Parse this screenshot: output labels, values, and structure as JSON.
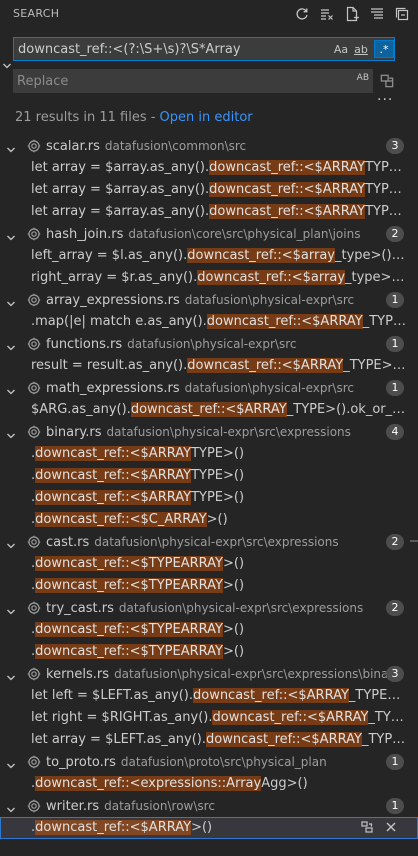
{
  "header": {
    "title": "SEARCH",
    "actions": [
      {
        "name": "refresh-icon",
        "label": "Refresh"
      },
      {
        "name": "clear-results-icon",
        "label": "Clear Search Results"
      },
      {
        "name": "new-search-editor-icon",
        "label": "Open New Search Editor"
      },
      {
        "name": "view-as-tree-icon",
        "label": "View as Tree"
      },
      {
        "name": "collapse-all-icon",
        "label": "Collapse All"
      }
    ]
  },
  "search": {
    "value": "downcast_ref::<(?:\\S+\\s)?\\S*Array",
    "match_case_label": "Aa",
    "whole_word_label": "ab",
    "regex_label": ".*"
  },
  "replace": {
    "placeholder": "Replace",
    "preserve_case_label": "AB"
  },
  "summary": {
    "text": "21 results in 11 files - ",
    "link": "Open in editor"
  },
  "files": [
    {
      "name": "scalar.rs",
      "path": "datafusion\\common\\src",
      "count": "3",
      "matches": [
        [
          {
            "t": "let array = $array.as_any()."
          },
          {
            "t": "downcast_ref::<$ARRAY",
            "h": true
          },
          {
            "t": "TYPE>().unwrap();"
          }
        ],
        [
          {
            "t": "let array = $array.as_any()."
          },
          {
            "t": "downcast_ref::<$ARRAY",
            "h": true
          },
          {
            "t": "TYPE>().unwrap();"
          }
        ],
        [
          {
            "t": "let array = $array.as_any()."
          },
          {
            "t": "downcast_ref::<$ARRAY",
            "h": true
          },
          {
            "t": "TYPE>().unwrap();"
          }
        ]
      ]
    },
    {
      "name": "hash_join.rs",
      "path": "datafusion\\core\\src\\physical_plan\\joins",
      "count": "2",
      "matches": [
        [
          {
            "t": "left_array = $l.as_any()."
          },
          {
            "t": "downcast_ref::<$array",
            "h": true
          },
          {
            "t": "_type>().unwrap();"
          }
        ],
        [
          {
            "t": "right_array = $r.as_any()."
          },
          {
            "t": "downcast_ref::<$array",
            "h": true
          },
          {
            "t": "_type>().unwrap();"
          }
        ]
      ]
    },
    {
      "name": "array_expressions.rs",
      "path": "datafusion\\physical-expr\\src",
      "count": "1",
      "matches": [
        [
          {
            "t": ".map(|e| match e.as_any()."
          },
          {
            "t": "downcast_ref::<$ARRAY",
            "h": true
          },
          {
            "t": "_TYPE>() {"
          }
        ]
      ]
    },
    {
      "name": "functions.rs",
      "path": "datafusion\\physical-expr\\src",
      "count": "1",
      "matches": [
        [
          {
            "t": "result = result.as_any()."
          },
          {
            "t": "downcast_ref::<$ARRAY",
            "h": true
          },
          {
            "t": "_TYPE>().unwrap();"
          }
        ]
      ]
    },
    {
      "name": "math_expressions.rs",
      "path": "datafusion\\physical-expr\\src",
      "count": "1",
      "matches": [
        [
          {
            "t": "$ARG.as_any()."
          },
          {
            "t": "downcast_ref::<$ARRAY",
            "h": true
          },
          {
            "t": "_TYPE>().ok_or_else(|| {"
          }
        ]
      ]
    },
    {
      "name": "binary.rs",
      "path": "datafusion\\physical-expr\\src\\expressions",
      "count": "4",
      "matches": [
        [
          {
            "t": "."
          },
          {
            "t": "downcast_ref::<$ARRAY",
            "h": true
          },
          {
            "t": "TYPE>()"
          }
        ],
        [
          {
            "t": "."
          },
          {
            "t": "downcast_ref::<$ARRAY",
            "h": true
          },
          {
            "t": "TYPE>()"
          }
        ],
        [
          {
            "t": "."
          },
          {
            "t": "downcast_ref::<$ARRAY",
            "h": true
          },
          {
            "t": "TYPE>()"
          }
        ],
        [
          {
            "t": "."
          },
          {
            "t": "downcast_ref::<$C_ARRAY",
            "h": true
          },
          {
            "t": ">()"
          }
        ]
      ]
    },
    {
      "name": "cast.rs",
      "path": "datafusion\\physical-expr\\src\\expressions",
      "count": "2",
      "matches": [
        [
          {
            "t": "."
          },
          {
            "t": "downcast_ref::<$TYPEARRAY",
            "h": true
          },
          {
            "t": ">()"
          }
        ],
        [
          {
            "t": "."
          },
          {
            "t": "downcast_ref::<$TYPEARRAY",
            "h": true
          },
          {
            "t": ">()"
          }
        ]
      ]
    },
    {
      "name": "try_cast.rs",
      "path": "datafusion\\physical-expr\\src\\expressions",
      "count": "2",
      "matches": [
        [
          {
            "t": "."
          },
          {
            "t": "downcast_ref::<$TYPEARRAY",
            "h": true
          },
          {
            "t": ">()"
          }
        ],
        [
          {
            "t": "."
          },
          {
            "t": "downcast_ref::<$TYPEARRAY",
            "h": true
          },
          {
            "t": ">()"
          }
        ]
      ]
    },
    {
      "name": "kernels.rs",
      "path": "datafusion\\physical-expr\\src\\expressions\\binary",
      "count": "3",
      "matches": [
        [
          {
            "t": "let left = $LEFT.as_any()."
          },
          {
            "t": "downcast_ref::<$ARRAY",
            "h": true
          },
          {
            "t": "_TYPE>().unwrap();"
          }
        ],
        [
          {
            "t": "let right = $RIGHT.as_any()."
          },
          {
            "t": "downcast_ref::<$ARRAY",
            "h": true
          },
          {
            "t": "_TYPE>().unwrap();"
          }
        ],
        [
          {
            "t": "let array = $LEFT.as_any()."
          },
          {
            "t": "downcast_ref::<$ARRAY",
            "h": true
          },
          {
            "t": "_TYPE>().unwrap();"
          }
        ]
      ]
    },
    {
      "name": "to_proto.rs",
      "path": "datafusion\\proto\\src\\physical_plan",
      "count": "1",
      "matches": [
        [
          {
            "t": "."
          },
          {
            "t": "downcast_ref::<expressions::Array",
            "h": true
          },
          {
            "t": "Agg>()"
          }
        ]
      ]
    },
    {
      "name": "writer.rs",
      "path": "datafusion\\row\\src",
      "count": "1",
      "matches": [
        [
          {
            "t": "."
          },
          {
            "t": "downcast_ref::<$ARRAY",
            "h": true
          },
          {
            "t": ">()"
          }
        ]
      ]
    }
  ]
}
